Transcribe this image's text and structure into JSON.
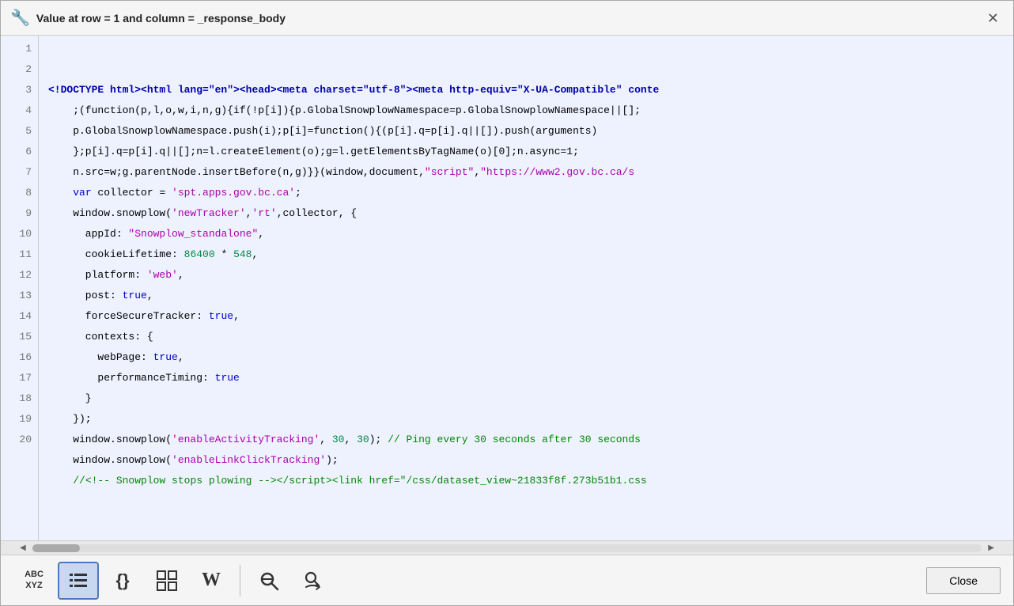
{
  "title": {
    "icon": "🔧",
    "text": "Value at row = 1 and column = _response_body"
  },
  "lines": [
    {
      "num": 1,
      "html": "<span class='tag'>&lt;!DOCTYPE html&gt;&lt;html lang=\"en\"&gt;&lt;head&gt;&lt;meta charset=\"utf-8\"&gt;&lt;meta http-equiv=\"X-UA-Compatible\" conte</span>"
    },
    {
      "num": 2,
      "html": "    ;(function(p,l,o,w,i,n,g){if(!p[i]){p.GlobalSnowplowNamespace=p.GlobalSnowplowNamespace||[];"
    },
    {
      "num": 3,
      "html": "    p.GlobalSnowplowNamespace.push(i);p[i]=function(){(p[i].q=p[i].q||[]).push(arguments)"
    },
    {
      "num": 4,
      "html": "    };p[i].q=p[i].q||[];n=l.createElement(o);g=l.getElementsByTagName(o)[0];n.async=1;"
    },
    {
      "num": 5,
      "html": "    n.src=w;g.parentNode.insertBefore(n,g)}}(window,document,<span class='str'>\"script\"</span>,<span class='str'>\"https://www2.gov.bc.ca/s</span>"
    },
    {
      "num": 6,
      "html": "    <span class='kw'>var</span> collector = <span class='str'>'spt.apps.gov.bc.ca'</span>;"
    },
    {
      "num": 7,
      "html": "    window.snowplow(<span class='str'>'newTracker'</span>,<span class='str'>'rt'</span>,collector, {"
    },
    {
      "num": 8,
      "html": "      appId: <span class='str'>\"Snowplow_standalone\"</span>,"
    },
    {
      "num": 9,
      "html": "      cookieLifetime: <span class='num'>86400</span> * <span class='num'>548</span>,"
    },
    {
      "num": 10,
      "html": "      platform: <span class='str'>'web'</span>,"
    },
    {
      "num": 11,
      "html": "      post: <span class='kw'>true</span>,"
    },
    {
      "num": 12,
      "html": "      forceSecureTracker: <span class='kw'>true</span>,"
    },
    {
      "num": 13,
      "html": "      contexts: {"
    },
    {
      "num": 14,
      "html": "        webPage: <span class='kw'>true</span>,"
    },
    {
      "num": 15,
      "html": "        performanceTiming: <span class='kw'>true</span>"
    },
    {
      "num": 16,
      "html": "      }"
    },
    {
      "num": 17,
      "html": "    });"
    },
    {
      "num": 18,
      "html": "    window.snowplow(<span class='str'>'enableActivityTracking'</span>, <span class='num'>30</span>, <span class='num'>30</span>); <span class='comment'>// Ping every 30 seconds after 30 seconds</span>"
    },
    {
      "num": 19,
      "html": "    window.snowplow(<span class='str'>'enableLinkClickTracking'</span>);"
    },
    {
      "num": 20,
      "html": "    <span class='comment'>//&lt;!-- Snowplow stops plowing --&gt;&lt;/script&gt;&lt;link href=\"/css/dataset_view~21833f8f.273b51b1.css</span>"
    }
  ],
  "toolbar": {
    "buttons": [
      {
        "id": "text-btn",
        "label": "ABC\nXYZ",
        "active": false,
        "type": "text"
      },
      {
        "id": "list-btn",
        "label": "list",
        "active": true,
        "type": "list"
      },
      {
        "id": "braces-btn",
        "label": "{}",
        "active": false,
        "type": "braces"
      },
      {
        "id": "grid-btn",
        "label": "grid",
        "active": false,
        "type": "grid"
      },
      {
        "id": "wiki-btn",
        "label": "W",
        "active": false,
        "type": "wiki"
      },
      {
        "id": "search-btn",
        "label": "search",
        "active": false,
        "type": "search"
      },
      {
        "id": "find-btn",
        "label": "find",
        "active": false,
        "type": "find"
      }
    ],
    "close_label": "Close"
  }
}
